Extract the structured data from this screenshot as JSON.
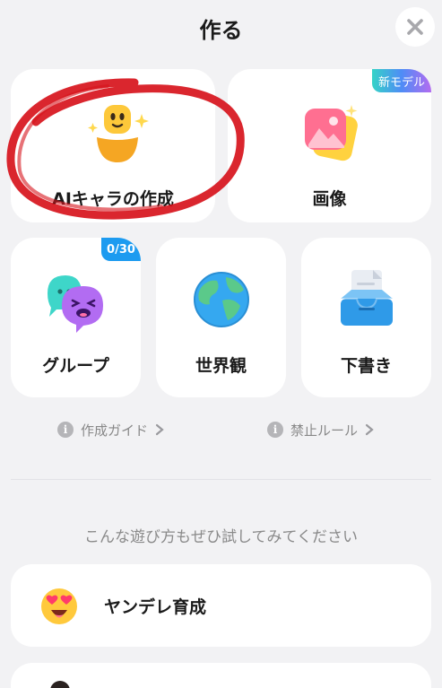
{
  "header": {
    "title": "作る",
    "close_icon": "close-icon"
  },
  "create_options": [
    {
      "id": "ai-character",
      "label": "AIキャラの作成",
      "icon": "smiling-character-icon"
    },
    {
      "id": "image",
      "label": "画像",
      "icon": "image-icon",
      "badge": "新モデル"
    },
    {
      "id": "group",
      "label": "グループ",
      "icon": "group-chat-icon",
      "badge": "0/30"
    },
    {
      "id": "worldview",
      "label": "世界観",
      "icon": "globe-icon"
    },
    {
      "id": "drafts",
      "label": "下書き",
      "icon": "inbox-drafts-icon"
    }
  ],
  "links": {
    "guide": "作成ガイド",
    "rules": "禁止ルール"
  },
  "suggestions": {
    "heading": "こんな遊び方もぜひ試してみてください",
    "items": [
      {
        "label": "ヤンデレ育成",
        "icon": "heart-eyes-emoji-icon"
      }
    ]
  },
  "colors": {
    "background": "#f2f2f4",
    "card": "#ffffff",
    "badge_blue": "#1d9bf0",
    "annotation_red": "#d7141c"
  }
}
